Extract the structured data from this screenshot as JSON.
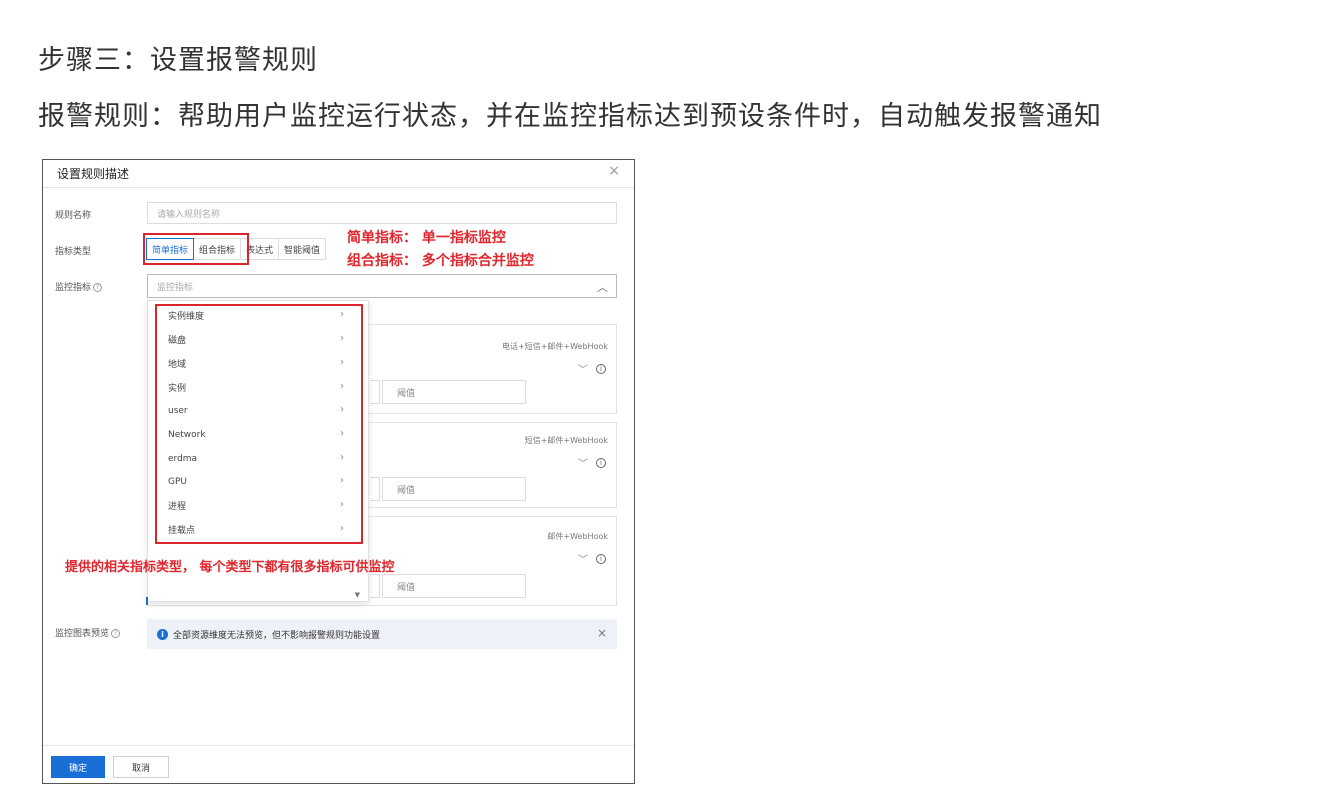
{
  "heading": {
    "step": "步骤三：设置报警规则",
    "desc": "报警规则：帮助用户监控运行状态，并在监控指标达到预设条件时，自动触发报警通知"
  },
  "dialog": {
    "title": "设置规则描述",
    "close": "×",
    "rule_name_label": "规则名称",
    "rule_name_placeholder": "请输入规则名称",
    "metric_type_label": "指标类型",
    "tabs": [
      "简单指标",
      "组合指标",
      "表达式",
      "智能阈值"
    ],
    "active_tab": "简单指标",
    "metric_label": "监控指标",
    "metric_placeholder": "监控指标",
    "dropdown_items": [
      "实例维度",
      "磁盘",
      "地域",
      "实例",
      "user",
      "Network",
      "erdma",
      "GPU",
      "进程",
      "挂载点"
    ],
    "panels": [
      {
        "channel": "电话+短信+邮件+WebHook",
        "threshold": "阈值"
      },
      {
        "channel": "短信+邮件+WebHook",
        "threshold": "阈值"
      },
      {
        "channel": "邮件+WebHook",
        "threshold": "阈值"
      }
    ],
    "preview_label": "监控图表预览",
    "notice": "全部资源维度无法预览，但不影响报警规则功能设置",
    "ok": "确定",
    "cancel": "取消"
  },
  "annotations": {
    "simple": "简单指标：  单一指标监控",
    "combo": "组合指标：  多个指标合并监控",
    "types": "提供的相关指标类型，  每个类型下都有很多指标可供监控"
  },
  "colors": {
    "accent": "#1a6fd6",
    "annotation": "#e1262d"
  }
}
